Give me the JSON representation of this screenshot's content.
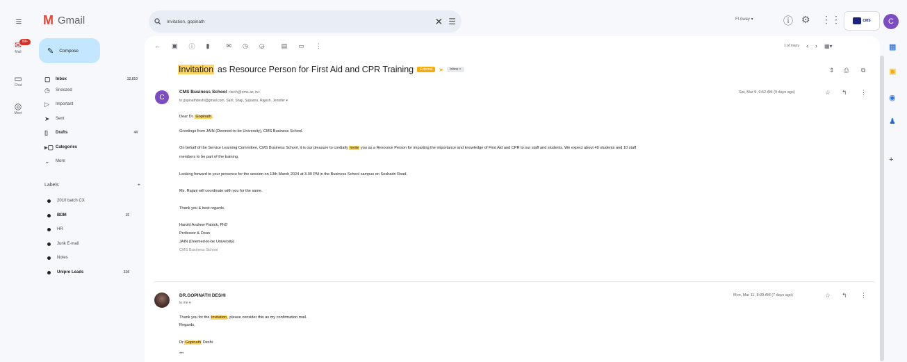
{
  "app": {
    "name": "Gmail",
    "logo_glyph": "M"
  },
  "search": {
    "value": "Invitation, gopinath"
  },
  "header": {
    "status": "Fl Away",
    "brand_text": "CMS",
    "avatar_letter": "C"
  },
  "rail": [
    {
      "icon": "mail-icon",
      "label": "Mail",
      "badge": "99+"
    },
    {
      "icon": "chat-icon",
      "label": "Chat"
    },
    {
      "icon": "meet-icon",
      "label": "Meet"
    }
  ],
  "compose": {
    "label": "Compose"
  },
  "nav": [
    {
      "icon": "inbox-icon",
      "label": "Inbox",
      "count": "12,810",
      "bold": true
    },
    {
      "icon": "snoozed-icon",
      "label": "Snoozed",
      "count": ""
    },
    {
      "icon": "important-icon",
      "label": "Important",
      "count": ""
    },
    {
      "icon": "sent-icon",
      "label": "Sent",
      "count": ""
    },
    {
      "icon": "drafts-icon",
      "label": "Drafts",
      "count": "44",
      "bold": true
    },
    {
      "icon": "categories-icon",
      "label": "Categories",
      "count": "",
      "bold": true
    },
    {
      "icon": "more-icon",
      "label": "More",
      "count": ""
    }
  ],
  "labels": {
    "header": "Labels",
    "add": "+",
    "items": [
      {
        "label": "2010 batch CX",
        "count": ""
      },
      {
        "label": "BDM",
        "count": "15",
        "bold": true
      },
      {
        "label": "HR",
        "count": ""
      },
      {
        "label": "Junk E-mail",
        "count": ""
      },
      {
        "label": "Notes",
        "count": ""
      },
      {
        "label": "Unipro Leads",
        "count": "228",
        "bold": true
      }
    ]
  },
  "pager": {
    "range": "1 of many"
  },
  "email": {
    "subject_highlight": "Invitation",
    "subject_rest": "as Resource Person for First Aid and CPR Training",
    "tag_external": "External",
    "tag_inbox": "Inbox ×",
    "messages": [
      {
        "avatar": "C",
        "sender": "CMS Business School",
        "sender_email": "<tech@cms.ac.in>",
        "to": "to gopinathdeshi@gmail.com, Sarit, Shaji, Suparna, Rajesh, Jennifer ▾",
        "time": "Sat, Mar 9, 9:52 AM (9 days ago)",
        "greeting_pre": "Dear Dr. ",
        "greeting_name": "Gopinath",
        "greeting_post": ",",
        "p1": "Greetings from JAIN (Deemed-to-be University), CMS Business School.",
        "p2_pre": "On behalf of the Service Learning Committee, CMS Business School, it is our pleasure to cordially ",
        "p2_hl": "invite",
        "p2_post": " you as a Resource Person for imparting the importance and knowledge of First Aid and CPR to our staff and students. We expect about 40 students and 10 staff",
        "p2_line2": "members to be part of the training.",
        "p3": "Looking forward to your presence for the session on 13th March 2024 at 3.00 PM in the Business School campus on Seshadri Road.",
        "p4": "Ms. Rajani will coordinate with you for the same.",
        "p5": "Thank you & best regards.",
        "sig": [
          "Harold Andrew Patrick, PhD",
          "Professor & Dean",
          "JAIN (Deemed-to-be University)",
          "CMS Business School"
        ]
      },
      {
        "sender": "DR.GOPINATH DESHI",
        "to": "to me ▾",
        "time": "Mon, Mar 11, 8:09 AM (7 days ago)",
        "line1_pre": "Thank you for the ",
        "line1_hl": "invitation",
        "line1_post": ", please consider this as my confirmation mail.",
        "line2": "Regards,",
        "sign_pre": "Dr ",
        "sign_hl": "Gopinath",
        "sign_post": " Deshi",
        "dots": "•••"
      }
    ]
  },
  "colors": {
    "accent": "#c2e7ff",
    "highlight": "#fdd663",
    "avatar": "#7b4cc2",
    "badge": "#d93025"
  }
}
